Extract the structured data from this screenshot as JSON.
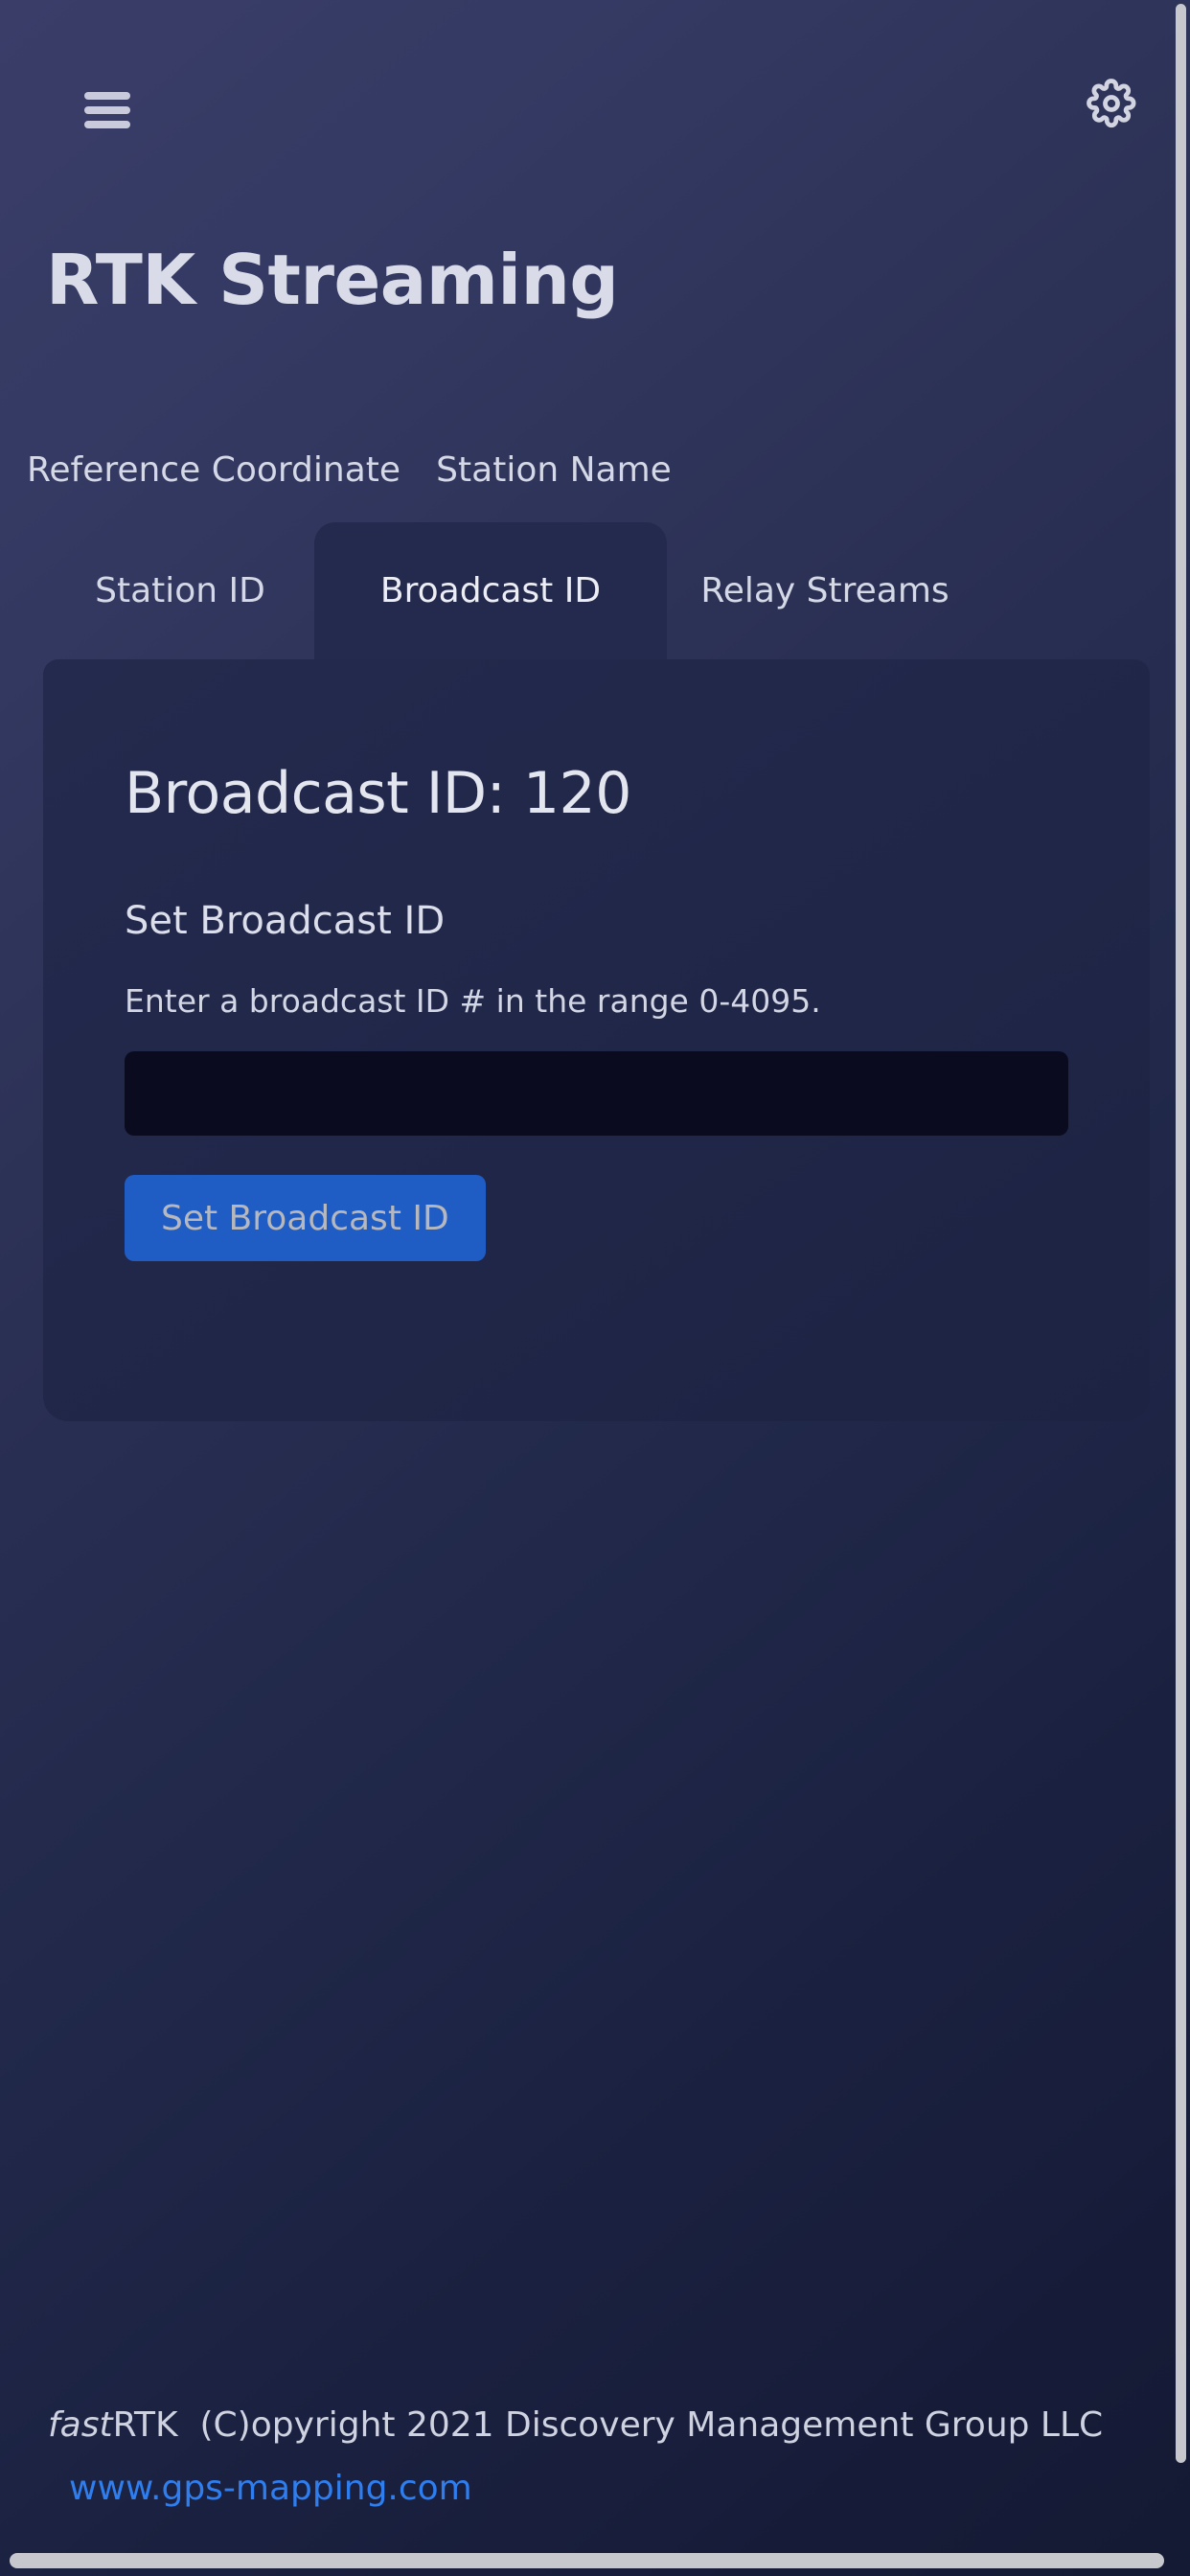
{
  "header": {
    "menu_icon": "hamburger-menu-icon",
    "settings_icon": "gear-icon",
    "title": "RTK Streaming"
  },
  "tabs": {
    "row1": [
      {
        "label": "Reference Coordinate",
        "active": false
      },
      {
        "label": "Station Name",
        "active": false
      }
    ],
    "row2": [
      {
        "label": "Station ID",
        "active": false
      },
      {
        "label": "Broadcast ID",
        "active": true
      },
      {
        "label": "Relay Streams",
        "active": false
      }
    ]
  },
  "panel": {
    "heading": "Broadcast ID: 120",
    "form": {
      "title": "Set Broadcast ID",
      "description": "Enter a broadcast ID # in the range 0-4095.",
      "input_value": "",
      "input_placeholder": "",
      "submit_label": "Set Broadcast ID"
    }
  },
  "footer": {
    "brand_italic": "fast",
    "brand_rest": "RTK",
    "copyright": "(C)opyright 2021 Discovery Management Group LLC",
    "link": "www.gps-mapping.com"
  },
  "colors": {
    "accent_button": "#1f5cc4",
    "link": "#2f7ef0",
    "panel_bg": "#242a4d",
    "input_bg": "#0b0b20",
    "text_primary": "#e3e5ef",
    "scrollbar": "#c6c8ce"
  }
}
